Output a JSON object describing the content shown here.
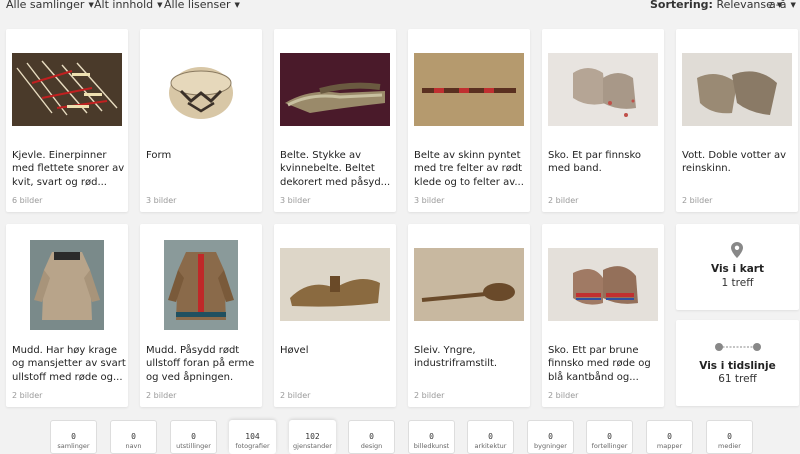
{
  "filters": {
    "collections": "Alle samlinger",
    "content": "Alt innhold",
    "licenses": "Alle lisenser"
  },
  "sort": {
    "label": "Sortering:",
    "value": "Relevanse",
    "order": "a-å"
  },
  "cards": [
    {
      "title": "Kjevle. Einerpinner med flettete snorer av kvit, svart og rød...",
      "count": "6 bilder"
    },
    {
      "title": "Form",
      "count": "3 bilder"
    },
    {
      "title": "Belte. Stykke av kvinnebelte. Beltet dekorert med påsyd...",
      "count": "3 bilder"
    },
    {
      "title": "Belte av skinn pyntet med tre felter av rødt klede og to felter av...",
      "count": "3 bilder"
    },
    {
      "title": "Sko. Et par finnsko med band.",
      "count": "2 bilder"
    },
    {
      "title": "Vott. Doble votter av reinskinn.",
      "count": "2 bilder"
    },
    {
      "title": "Mudd. Har høy krage og mansjetter av svart ullstoff med røde og...",
      "count": "2 bilder"
    },
    {
      "title": "Mudd. Påsydd rødt ullstoff foran på erme og ved åpningen.",
      "count": "2 bilder"
    },
    {
      "title": "Høvel",
      "count": "2 bilder"
    },
    {
      "title": "Sleiv. Yngre, industriframstilt.",
      "count": "2 bilder"
    },
    {
      "title": "Sko. Ett par brune finnsko med røde og blå kantbånd og...",
      "count": "2 bilder"
    }
  ],
  "map_card": {
    "label": "Vis i kart",
    "count": "1 treff"
  },
  "timeline_card": {
    "label": "Vis i tidslinje",
    "count": "61 treff"
  },
  "categories": [
    {
      "num": "0",
      "label": "samlinger"
    },
    {
      "num": "0",
      "label": "navn"
    },
    {
      "num": "0",
      "label": "utstillinger"
    },
    {
      "num": "104",
      "label": "fotografier"
    },
    {
      "num": "102",
      "label": "gjenstander"
    },
    {
      "num": "0",
      "label": "design"
    },
    {
      "num": "0",
      "label": "billedkunst"
    },
    {
      "num": "0",
      "label": "arkitektur"
    },
    {
      "num": "0",
      "label": "bygninger"
    },
    {
      "num": "0",
      "label": "fortellinger"
    },
    {
      "num": "0",
      "label": "mapper"
    },
    {
      "num": "0",
      "label": "medier"
    }
  ]
}
